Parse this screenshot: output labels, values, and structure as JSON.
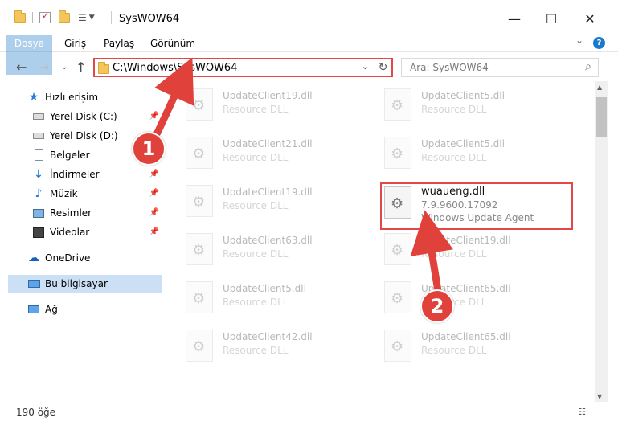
{
  "window": {
    "title": "SysWOW64",
    "minimize_glyph": "—",
    "maximize_glyph": "☐",
    "close_glyph": "✕"
  },
  "ribbon": {
    "tabs": [
      "Dosya",
      "Giriş",
      "Paylaş",
      "Görünüm"
    ],
    "chevron_glyph": "⌄",
    "help_glyph": "?"
  },
  "address": {
    "path": "C:\\Windows\\SysWOW64",
    "dropdown_glyph": "⌄",
    "refresh_glyph": "↻"
  },
  "search": {
    "placeholder": "Ara: SysWOW64",
    "icon_glyph": "⌕"
  },
  "nav_buttons": {
    "back": "←",
    "forward": "→",
    "recent": "⌄",
    "up": "↑"
  },
  "sidebar": {
    "items": [
      {
        "label": "Hızlı erişim",
        "icon": "star-icon"
      },
      {
        "label": "Yerel Disk (C:)",
        "icon": "drive-icon",
        "pinned": true
      },
      {
        "label": "Yerel Disk (D:)",
        "icon": "drive-icon",
        "pinned": true
      },
      {
        "label": "Belgeler",
        "icon": "document-icon",
        "pinned": true
      },
      {
        "label": "İndirmeler",
        "icon": "download-icon",
        "pinned": true
      },
      {
        "label": "Müzik",
        "icon": "music-icon",
        "pinned": true
      },
      {
        "label": "Resimler",
        "icon": "picture-icon",
        "pinned": true
      },
      {
        "label": "Videolar",
        "icon": "video-icon",
        "pinned": true
      },
      {
        "label": "OneDrive",
        "icon": "cloud-icon"
      },
      {
        "label": "Bu bilgisayar",
        "icon": "computer-icon",
        "selected": true
      },
      {
        "label": "Ağ",
        "icon": "network-icon"
      }
    ],
    "pin_glyph": "📌"
  },
  "files": {
    "left_column": [
      {
        "name": "UpdateClient19.dll",
        "desc": "Resource DLL"
      },
      {
        "name": "UpdateClient21.dll",
        "desc": "Resource DLL"
      },
      {
        "name": "UpdateClient19.dll",
        "desc": "Resource DLL"
      },
      {
        "name": "UpdateClient63.dll",
        "desc": "Resource DLL"
      },
      {
        "name": "UpdateClient5.dll",
        "desc": "Resource DLL"
      },
      {
        "name": "UpdateClient42.dll",
        "desc": "Resource DLL"
      }
    ],
    "right_column": [
      {
        "name": "UpdateClient5.dll",
        "desc": "Resource DLL"
      },
      {
        "name": "UpdateClient5.dll",
        "desc": "Resource DLL"
      },
      {
        "name": "wuaueng.dll",
        "desc": "7.9.9600.17092",
        "desc2": "Windows Update Agent",
        "active": true
      },
      {
        "name": "UpdateClient19.dll",
        "desc": "Resource DLL"
      },
      {
        "name": "UpdateClient65.dll",
        "desc": "Resource DLL"
      },
      {
        "name": "UpdateClient65.dll",
        "desc": "Resource DLL"
      }
    ]
  },
  "status": {
    "count": "190 öğe"
  },
  "annotations": {
    "step1": "1",
    "step2": "2",
    "color": "#e0413b"
  }
}
